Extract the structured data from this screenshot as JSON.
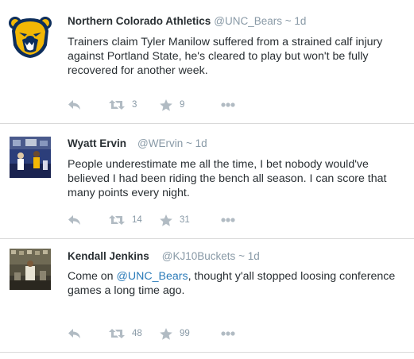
{
  "tweets": [
    {
      "name": "Northern Colorado Athletics",
      "handle": "@UNC_Bears",
      "separator": "~",
      "time": "1d",
      "text": "Trainers claim Tyler Manilow suffered from a strained calf injury against Portland State, he's cleared to play but won't be fully recovered for another week.",
      "retweets": "3",
      "favorites": "9"
    },
    {
      "name": "Wyatt Ervin",
      "handle": "@WErvin",
      "separator": "~",
      "time": "1d",
      "text": "People underestimate me all the time, I bet nobody would've believed I had been riding the bench all season. I can score that many points every night.",
      "retweets": "14",
      "favorites": "31"
    },
    {
      "name": "Kendall Jenkins",
      "handle": "@KJ10Buckets",
      "separator": "~",
      "time": "1d",
      "text_before": "Come on ",
      "mention": "@UNC_Bears",
      "text_after": ", thought y'all stopped loosing conference games a long time ago.",
      "retweets": "48",
      "favorites": "99"
    }
  ],
  "colors": {
    "name": "#292f33",
    "meta": "#8899a6",
    "link": "#2b7bb9",
    "icon": "#b1bbc3",
    "divider": "#d9d9d9",
    "bear_gold": "#f2b705",
    "bear_navy": "#0d2e5c"
  },
  "icons": {
    "reply": "reply-icon",
    "retweet": "retweet-icon",
    "favorite": "star-icon",
    "more": "more-dots-icon"
  }
}
